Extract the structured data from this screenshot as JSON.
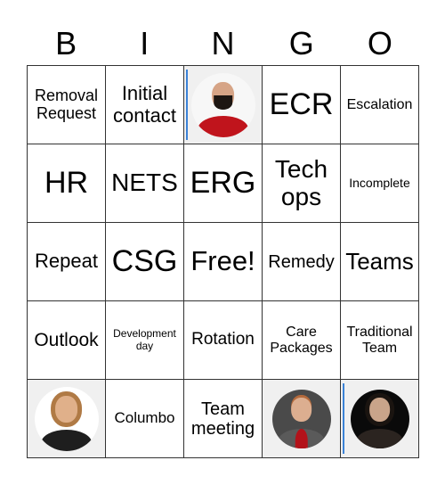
{
  "header": {
    "letters": [
      "B",
      "I",
      "N",
      "G",
      "O"
    ]
  },
  "board": {
    "rows": [
      [
        {
          "type": "text",
          "text": "Removal Request"
        },
        {
          "type": "text",
          "text": "Initial contact"
        },
        {
          "type": "photo",
          "description": "man-with-beard-red-jacket"
        },
        {
          "type": "text",
          "text": "ECR"
        },
        {
          "type": "text",
          "text": "Escalation"
        }
      ],
      [
        {
          "type": "text",
          "text": "HR"
        },
        {
          "type": "text",
          "text": "NETS"
        },
        {
          "type": "text",
          "text": "ERG"
        },
        {
          "type": "text",
          "text": "Tech ops"
        },
        {
          "type": "text",
          "text": "Incomplete"
        }
      ],
      [
        {
          "type": "text",
          "text": "Repeat"
        },
        {
          "type": "text",
          "text": "CSG"
        },
        {
          "type": "text",
          "text": "Free!"
        },
        {
          "type": "text",
          "text": "Remedy"
        },
        {
          "type": "text",
          "text": "Teams"
        }
      ],
      [
        {
          "type": "text",
          "text": "Outlook"
        },
        {
          "type": "text",
          "text": "Development day"
        },
        {
          "type": "text",
          "text": "Rotation"
        },
        {
          "type": "text",
          "text": "Care Packages"
        },
        {
          "type": "text",
          "text": "Traditional Team"
        }
      ],
      [
        {
          "type": "photo",
          "description": "woman-blonde-hair"
        },
        {
          "type": "text",
          "text": "Columbo"
        },
        {
          "type": "text",
          "text": "Team meeting"
        },
        {
          "type": "photo",
          "description": "man-red-shirt-gray-suit"
        },
        {
          "type": "photo",
          "description": "woman-curly-hair-dark-background"
        }
      ]
    ]
  },
  "colors": {
    "grid_line": "#333333",
    "photo_bg": "#f0f0f0",
    "accent": "#3b82d6"
  }
}
